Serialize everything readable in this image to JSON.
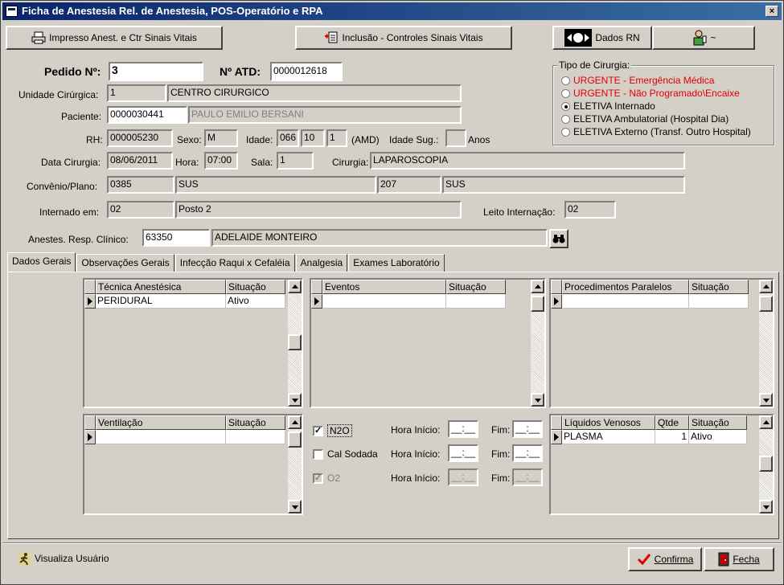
{
  "window": {
    "title": "Ficha de Anestesia  Rel. de Anestesia, POS-Operatório e RPA",
    "close_label": "×"
  },
  "toolbar": {
    "print_label": "Impresso Anest. e Ctr Sinais Vitais",
    "inclusion_label": "Inclusão - Controles Sinais Vitais",
    "rn_label": "Dados RN",
    "user_label": "~"
  },
  "form": {
    "pedido_label": "Pedido Nº:",
    "pedido_value": "3",
    "atd_label": "Nº ATD:",
    "atd_value": "0000012618",
    "unidade_label": "Unidade Cirúrgica:",
    "unidade_code": "1",
    "unidade_name": "CENTRO CIRURGICO",
    "paciente_label": "Paciente:",
    "paciente_code": "0000030441",
    "paciente_name": "PAULO EMILIO BERSANI",
    "rh_label": "RH:",
    "rh_value": "000005230",
    "sexo_label": "Sexo:",
    "sexo_value": "M",
    "idade_label": "Idade:",
    "idade_a": "066",
    "idade_m": "10",
    "idade_d": "1",
    "idade_unit": "(AMD)",
    "idade_sug_label": "Idade Sug.:",
    "idade_sug_value": "",
    "anos_label": "Anos",
    "data_label": "Data Cirurgia:",
    "data_value": "08/06/2011",
    "hora_label": "Hora:",
    "hora_value": "07:00",
    "sala_label": "Sala:",
    "sala_value": "1",
    "cirurgia_label": "Cirurgia:",
    "cirurgia_value": "LAPAROSCOPIA",
    "convenio_label": "Convênio/Plano:",
    "convenio_code": "0385",
    "convenio_name": "SUS",
    "plano_code": "207",
    "plano_name": "SUS",
    "internado_label": "Internado em:",
    "internado_code": "02",
    "internado_name": "Posto 2",
    "leito_label": "Leito Internação:",
    "leito_value": "02",
    "anestes_label": "Anestes. Resp. Clínico:",
    "anestes_code": "63350",
    "anestes_name": "ADELAIDE MONTEIRO"
  },
  "tipo_cirurgia": {
    "title": "Tipo de Cirurgia:",
    "options": [
      {
        "label": "URGENTE - Emergência Médica",
        "color": "#e00000",
        "selected": false
      },
      {
        "label": "URGENTE - Não Programado\\Encaixe",
        "color": "#e00000",
        "selected": false
      },
      {
        "label": "ELETIVA Internado",
        "color": "#000000",
        "selected": true
      },
      {
        "label": "ELETIVA Ambulatorial (Hospital Dia)",
        "color": "#000000",
        "selected": false
      },
      {
        "label": "ELETIVA Externo (Transf. Outro Hospital)",
        "color": "#000000",
        "selected": false
      }
    ]
  },
  "tabs": [
    "Dados Gerais",
    "Observações Gerais",
    "Infecção Raqui x Cefaléia",
    "Analgesia",
    "Exames Laboratório"
  ],
  "grids": {
    "tecnica": {
      "cols": [
        "Técnica Anestésica",
        "Situação"
      ],
      "rows": [
        [
          "PERIDURAL",
          "Ativo"
        ]
      ]
    },
    "eventos": {
      "cols": [
        "Eventos",
        "Situação"
      ],
      "rows": [
        [
          "",
          ""
        ]
      ]
    },
    "procedimentos": {
      "cols": [
        "Procedimentos Paralelos",
        "Situação"
      ],
      "rows": [
        [
          "",
          ""
        ]
      ]
    },
    "ventilacao": {
      "cols": [
        "Ventilação",
        "Situação"
      ],
      "rows": [
        [
          "",
          ""
        ]
      ]
    },
    "liquidos": {
      "cols": [
        "Líquidos Venosos",
        "Qtde",
        "Situação"
      ],
      "rows": [
        [
          "PLASMA",
          "1",
          "Ativo"
        ]
      ]
    }
  },
  "gases": {
    "hora_inicio_label": "Hora Início:",
    "fim_label": "Fim:",
    "time_placeholder": "__:__",
    "items": [
      {
        "label": "N2O",
        "checked": true,
        "disabled": false
      },
      {
        "label": "Cal Sodada",
        "checked": false,
        "disabled": false
      },
      {
        "label": "O2",
        "checked": true,
        "disabled": true
      }
    ]
  },
  "footer": {
    "visualiza_label": "Visualiza Usuário",
    "confirma_label": "Confirma",
    "fecha_label": "Fecha"
  }
}
